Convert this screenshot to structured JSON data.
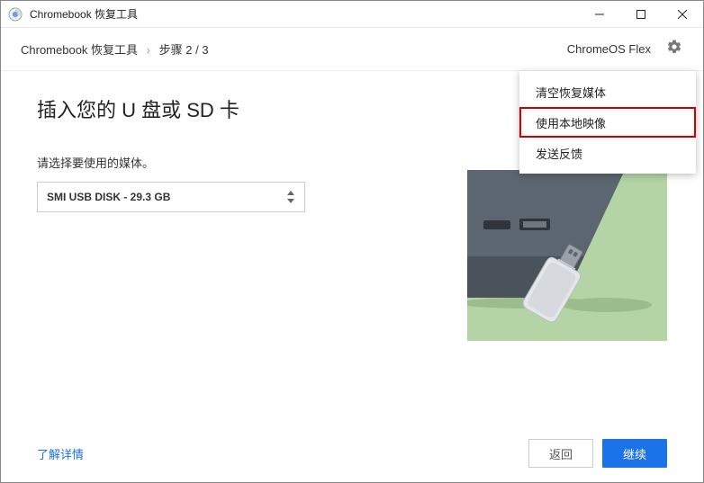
{
  "titlebar": {
    "title": "Chromebook 恢复工具"
  },
  "header": {
    "breadcrumb_app": "Chromebook 恢复工具",
    "breadcrumb_step": "步骤 2 / 3",
    "product": "ChromeOS Flex"
  },
  "menu": {
    "items": [
      {
        "label": "清空恢复媒体",
        "highlight": false
      },
      {
        "label": "使用本地映像",
        "highlight": true
      },
      {
        "label": "发送反馈",
        "highlight": false
      }
    ]
  },
  "content": {
    "heading": "插入您的 U 盘或 SD 卡",
    "instruction": "请选择要使用的媒体。",
    "selected_media": "SMI USB DISK - 29.3 GB"
  },
  "footer": {
    "learn_more": "了解详情",
    "back": "返回",
    "continue": "继续"
  }
}
